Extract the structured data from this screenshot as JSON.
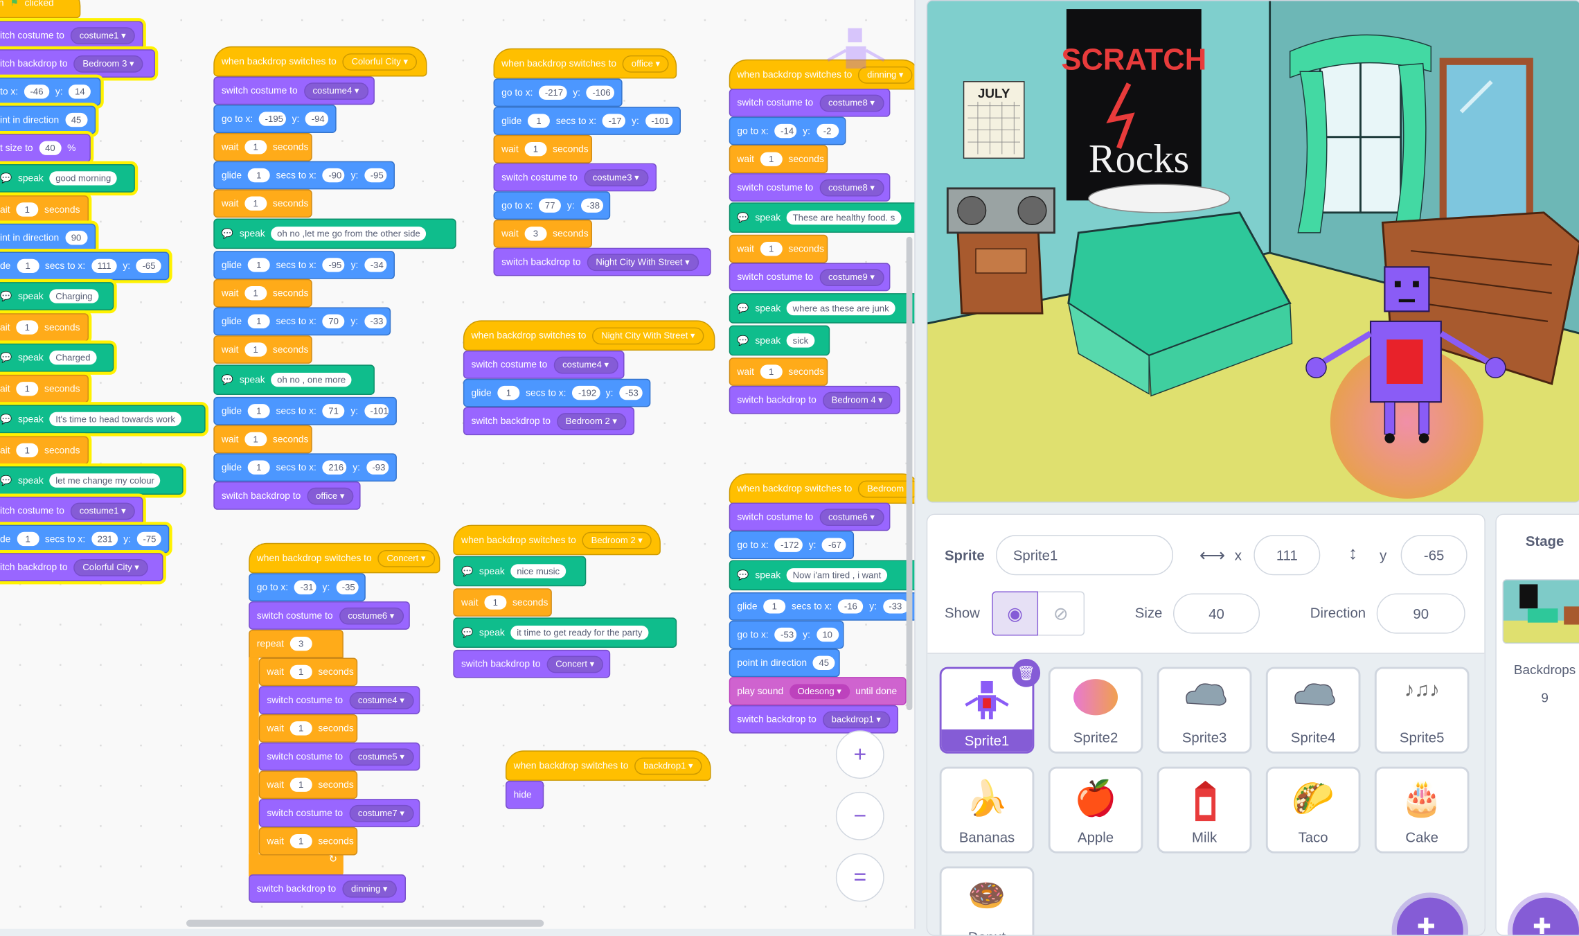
{
  "scripts": {
    "s1": {
      "hat_prefix": "hen",
      "hat_label": "clicked",
      "b1_label": "itch costume to",
      "b1_val": "costume1",
      "b2_label": "itch backdrop to",
      "b2_val": "Bedroom 3",
      "b3_label": "to x:",
      "b3_x": "-46",
      "b3_ylabel": "y:",
      "b3_y": "14",
      "b4_label": "int in direction",
      "b4_val": "45",
      "b5_label": "t size to",
      "b5_val": "40",
      "b5_pct": "%",
      "b6_label": "speak",
      "b6_val": "good morning",
      "b7_label": "ait",
      "b7_val": "1",
      "b7_unit": "seconds",
      "b8_label": "int in direction",
      "b8_val": "90",
      "b9_label": "de",
      "b9_secs": "1",
      "b9_mid": "secs to x:",
      "b9_x": "111",
      "b9_ylabel": "y:",
      "b9_y": "-65",
      "b10_label": "speak",
      "b10_val": "Charging",
      "b11_label": "ait",
      "b11_val": "1",
      "b11_unit": "seconds",
      "b12_label": "speak",
      "b12_val": "Charged",
      "b13_label": "ait",
      "b13_val": "1",
      "b13_unit": "seconds",
      "b14_label": "speak",
      "b14_val": "It's time to head towards work",
      "b15_label": "ait",
      "b15_val": "1",
      "b15_unit": "seconds",
      "b16_label": "speak",
      "b16_val": "let me change my colour",
      "b17_label": "itch costume to",
      "b17_val": "costume1",
      "b18_label": "de",
      "b18_secs": "1",
      "b18_mid": "secs to x:",
      "b18_x": "231",
      "b18_ylabel": "y:",
      "b18_y": "-75",
      "b19_label": "itch backdrop to",
      "b19_val": "Colorful City"
    },
    "s2": {
      "hat_label": "when backdrop switches to",
      "hat_val": "Colorful City",
      "b1_label": "switch costume to",
      "b1_val": "costume4",
      "b2_label": "go to x:",
      "b2_x": "-195",
      "b2_ylabel": "y:",
      "b2_y": "-94",
      "b3_label": "wait",
      "b3_val": "1",
      "b3_unit": "seconds",
      "b4_label": "glide",
      "b4_secs": "1",
      "b4_mid": "secs to x:",
      "b4_x": "-90",
      "b4_ylabel": "y:",
      "b4_y": "-95",
      "b5_label": "wait",
      "b5_val": "1",
      "b5_unit": "seconds",
      "b6_label": "speak",
      "b6_val": "oh no ,let me go from the other side",
      "b7_label": "glide",
      "b7_secs": "1",
      "b7_mid": "secs to x:",
      "b7_x": "-95",
      "b7_ylabel": "y:",
      "b7_y": "-34",
      "b8_label": "wait",
      "b8_val": "1",
      "b8_unit": "seconds",
      "b9_label": "glide",
      "b9_secs": "1",
      "b9_mid": "secs to x:",
      "b9_x": "70",
      "b9_ylabel": "y:",
      "b9_y": "-33",
      "b10_label": "wait",
      "b10_val": "1",
      "b10_unit": "seconds",
      "b11_label": "speak",
      "b11_val": "oh no , one more",
      "b12_label": "glide",
      "b12_secs": "1",
      "b12_mid": "secs to x:",
      "b12_x": "71",
      "b12_ylabel": "y:",
      "b12_y": "-101",
      "b13_label": "wait",
      "b13_val": "1",
      "b13_unit": "seconds",
      "b14_label": "glide",
      "b14_secs": "1",
      "b14_mid": "secs to x:",
      "b14_x": "216",
      "b14_ylabel": "y:",
      "b14_y": "-93",
      "b15_label": "switch backdrop to",
      "b15_val": "office"
    },
    "s3": {
      "hat_label": "when backdrop switches to",
      "hat_val": "Concert",
      "b1_label": "go to x:",
      "b1_x": "-31",
      "b1_ylabel": "y:",
      "b1_y": "-35",
      "b2_label": "switch costume to",
      "b2_val": "costume6",
      "b3_label": "repeat",
      "b3_val": "3",
      "b4_label": "wait",
      "b4_val": "1",
      "b4_unit": "seconds",
      "b5_label": "switch costume to",
      "b5_val": "costume4",
      "b6_label": "wait",
      "b6_val": "1",
      "b6_unit": "seconds",
      "b7_label": "switch costume to",
      "b7_val": "costume5",
      "b8_label": "wait",
      "b8_val": "1",
      "b8_unit": "seconds",
      "b9_label": "switch costume to",
      "b9_val": "costume7",
      "b10_label": "wait",
      "b10_val": "1",
      "b10_unit": "seconds",
      "b11_label": "switch backdrop to",
      "b11_val": "dinning"
    },
    "s4": {
      "hat_label": "when backdrop switches to",
      "hat_val": "office",
      "b1_label": "go to x:",
      "b1_x": "-217",
      "b1_ylabel": "y:",
      "b1_y": "-106",
      "b2_label": "glide",
      "b2_secs": "1",
      "b2_mid": "secs to x:",
      "b2_x": "-17",
      "b2_ylabel": "y:",
      "b2_y": "-101",
      "b3_label": "wait",
      "b3_val": "1",
      "b3_unit": "seconds",
      "b4_label": "switch costume to",
      "b4_val": "costume3",
      "b5_label": "go to x:",
      "b5_x": "77",
      "b5_ylabel": "y:",
      "b5_y": "-38",
      "b6_label": "wait",
      "b6_val": "3",
      "b6_unit": "seconds",
      "b7_label": "switch backdrop to",
      "b7_val": "Night City With Street"
    },
    "s5": {
      "hat_label": "when backdrop switches to",
      "hat_val": "Night City With Street",
      "b1_label": "switch costume to",
      "b1_val": "costume4",
      "b2_label": "glide",
      "b2_secs": "1",
      "b2_mid": "secs to x:",
      "b2_x": "-192",
      "b2_ylabel": "y:",
      "b2_y": "-53",
      "b3_label": "switch backdrop to",
      "b3_val": "Bedroom 2"
    },
    "s6": {
      "hat_label": "when backdrop switches to",
      "hat_val": "Bedroom 2",
      "b1_label": "speak",
      "b1_val": "nice music",
      "b2_label": "wait",
      "b2_val": "1",
      "b2_unit": "seconds",
      "b3_label": "speak",
      "b3_val": "it time to get ready for the party",
      "b4_label": "switch backdrop to",
      "b4_val": "Concert"
    },
    "s7": {
      "hat_label": "when backdrop switches to",
      "hat_val": "backdrop1",
      "b1_label": "hide"
    },
    "s8": {
      "hat_label": "when backdrop switches to",
      "hat_val": "dinning",
      "b1_label": "switch costume to",
      "b1_val": "costume8",
      "b2_label": "go to x:",
      "b2_x": "-14",
      "b2_ylabel": "y:",
      "b2_y": "-2",
      "b3_label": "wait",
      "b3_val": "1",
      "b3_unit": "seconds",
      "b4_label": "switch costume to",
      "b4_val": "costume8",
      "b5_label": "speak",
      "b5_val": "These are healthy food. s",
      "b6_label": "wait",
      "b6_val": "1",
      "b6_unit": "seconds",
      "b7_label": "switch costume to",
      "b7_val": "costume9",
      "b8_label": "speak",
      "b8_val": "where as these are junk",
      "b9_label": "speak",
      "b9_val": "sick",
      "b10_label": "wait",
      "b10_val": "1",
      "b10_unit": "seconds",
      "b11_label": "switch backdrop to",
      "b11_val": "Bedroom 4"
    },
    "s9": {
      "hat_label": "when backdrop switches to",
      "hat_val": "Bedroom",
      "b1_label": "switch costume to",
      "b1_val": "costume6",
      "b2_label": "go to x:",
      "b2_x": "-172",
      "b2_ylabel": "y:",
      "b2_y": "-67",
      "b3_label": "speak",
      "b3_val": "Now i'am tired , i want",
      "b4_label": "glide",
      "b4_secs": "1",
      "b4_mid": "secs to x:",
      "b4_x": "-16",
      "b4_ylabel": "y:",
      "b4_y": "-33",
      "b5_label": "go to x:",
      "b5_x": "-53",
      "b5_ylabel": "y:",
      "b5_y": "10",
      "b6_label": "point in direction",
      "b6_val": "45",
      "b7_label": "play sound",
      "b7_val": "Odesong",
      "b7_suffix": "until done",
      "b8_label": "switch backdrop to",
      "b8_val": "backdrop1"
    }
  },
  "zoom": {
    "in": "+",
    "out": "−",
    "reset": "="
  },
  "stage_art": {
    "poster_line1": "SCRATCH",
    "poster_line2": "Rocks",
    "calendar": "JULY"
  },
  "sprite_info": {
    "sprite_label": "Sprite",
    "sprite_name": "Sprite1",
    "x_label": "x",
    "x_value": "111",
    "y_label": "y",
    "y_value": "-65",
    "show_label": "Show",
    "size_label": "Size",
    "size_value": "40",
    "direction_label": "Direction",
    "direction_value": "90"
  },
  "sprites": [
    "Sprite1",
    "Sprite2",
    "Sprite3",
    "Sprite4",
    "Sprite5",
    "Bananas",
    "Apple",
    "Milk",
    "Taco",
    "Cake",
    "Donut"
  ],
  "stage_panel": {
    "title": "Stage",
    "backdrops_label": "Backdrops",
    "backdrops_count": "9"
  },
  "colors": {
    "events": "#ffbf00",
    "looks": "#9966ff",
    "motion": "#4c97ff",
    "control": "#ffab19",
    "sound": "#cf63cf",
    "extension": "#0fbd8c",
    "accent": "#855cd6"
  }
}
